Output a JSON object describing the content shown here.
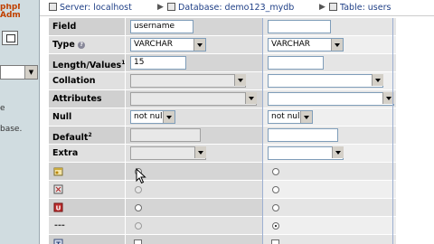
{
  "left_panel": {
    "logo_text": "phpMy Admin",
    "select_value": "",
    "text_lines": [
      "e",
      "base."
    ]
  },
  "breadcrumb": {
    "server": "Server: localhost",
    "database": "Database: demo123_mydb",
    "table": "Table: users"
  },
  "rows": {
    "field": {
      "label": "Field",
      "col1": "username",
      "col2": ""
    },
    "type": {
      "label": "Type",
      "col1": "VARCHAR",
      "col2": "VARCHAR"
    },
    "length": {
      "label": "Length/Values",
      "sup": "1",
      "col1": "15",
      "col2": ""
    },
    "collation": {
      "label": "Collation",
      "col1": "",
      "col2": ""
    },
    "attributes": {
      "label": "Attributes",
      "col1": "",
      "col2": ""
    },
    "null": {
      "label": "Null",
      "col1": "not null",
      "col2": "not null"
    },
    "default": {
      "label": "Default",
      "sup": "2",
      "col1": "",
      "col2": ""
    },
    "extra": {
      "label": "Extra",
      "col1": "",
      "col2": ""
    }
  },
  "key_rows": [
    {
      "icon": "primary-key-icon",
      "col1": "radio-selected",
      "col2": "radio"
    },
    {
      "icon": "index-icon",
      "col1": "radio-disabled",
      "col2": "radio"
    },
    {
      "icon": "unique-icon",
      "col1": "radio",
      "col2": "radio"
    },
    {
      "icon": "no-index-dash",
      "col1": "radio-disabled",
      "col2": "radio-selected"
    },
    {
      "icon": "fulltext-icon",
      "col1": "checkbox",
      "col2": "checkbox"
    }
  ],
  "colors": {
    "label_bg": "#d0d0d0",
    "cell_bg": "#e5e5e5",
    "link": "#1f3f86",
    "sidebar": "#d0dce0"
  }
}
